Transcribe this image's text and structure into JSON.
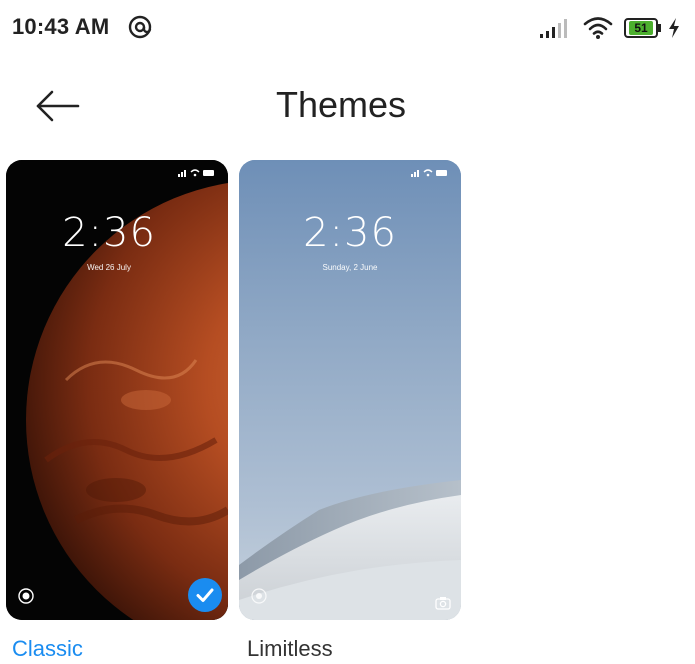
{
  "status_bar": {
    "time": "10:43 AM",
    "app_icon": "at-sign-notification-icon",
    "signal_icon": "cellular-signal-icon",
    "wifi_icon": "wifi-icon",
    "battery_level": "51",
    "charging_icon": "charging-bolt-icon"
  },
  "header": {
    "back_icon": "back-arrow-icon",
    "title": "Themes"
  },
  "themes": [
    {
      "name": "Classic",
      "lock_time": "2:36",
      "lock_date": "Wed 26 July",
      "selected": true,
      "label_color": "#1a8cf0"
    },
    {
      "name": "Limitless",
      "lock_time": "2:36",
      "lock_date": "Sunday, 2 June",
      "selected": false
    }
  ],
  "colors": {
    "accent": "#1a8cf0",
    "background": "#ffffff",
    "text": "#222222"
  }
}
